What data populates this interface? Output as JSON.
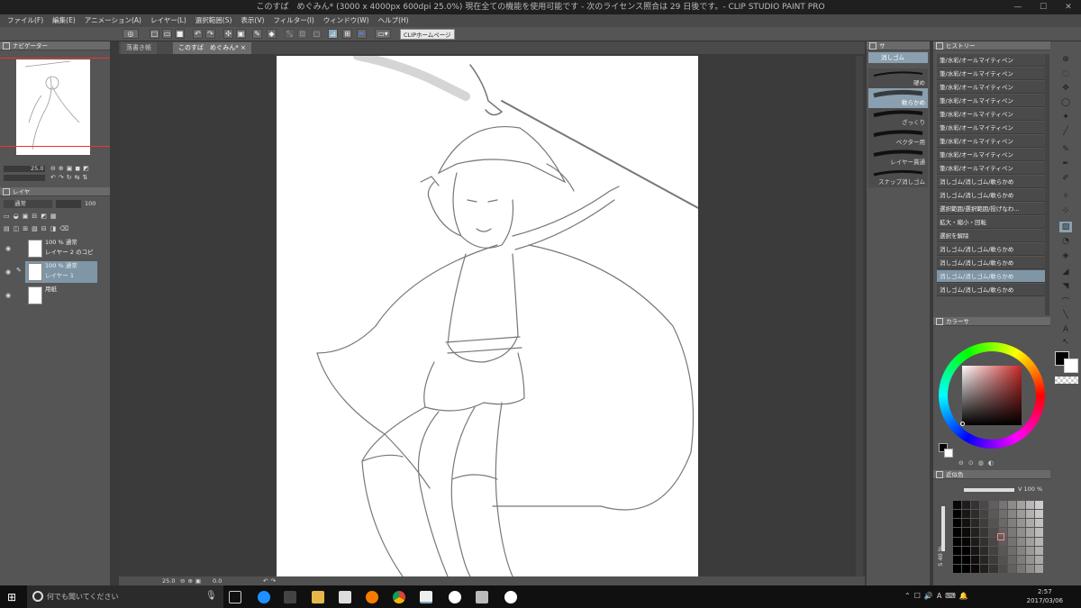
{
  "window": {
    "title": "このすば　めぐみん* (3000 x 4000px 600dpi 25.0%)  現在全ての機能を使用可能です - 次のライセンス照合は 29 日後です。- CLIP STUDIO PAINT PRO"
  },
  "menu": [
    "ファイル(F)",
    "編集(E)",
    "アニメーション(A)",
    "レイヤー(L)",
    "選択範囲(S)",
    "表示(V)",
    "フィルター(I)",
    "ウィンドウ(W)",
    "ヘルプ(H)"
  ],
  "toolbar": {
    "home_label": "CLIPホームページ"
  },
  "navigator": {
    "title": "ナビゲーター",
    "zoom": "25.0"
  },
  "layers": {
    "title": "レイヤ",
    "blend_mode": "通常",
    "opacity": "100",
    "items": [
      {
        "opacity_mode": "100 %  通常",
        "name": "レイヤー 2 のコピー"
      },
      {
        "opacity_mode": "100 %  通常",
        "name": "レイヤー 1"
      },
      {
        "opacity_mode": "",
        "name": "用紙"
      }
    ]
  },
  "canvas": {
    "tabs": [
      "落書き帳",
      "このすば　めぐみん*"
    ],
    "zoom": "25.0",
    "rotation": "0.0"
  },
  "subtool": {
    "title": "消しゴム",
    "tab": "サ",
    "brushes": [
      "硬め",
      "軟らかめ",
      "ざっくり",
      "ベクター用",
      "レイヤー貫通",
      "スナップ消しゴム"
    ]
  },
  "history": {
    "title": "ヒストリー",
    "items": [
      "筆/水彩/オールマイティペン",
      "筆/水彩/オールマイティペン",
      "筆/水彩/オールマイティペン",
      "筆/水彩/オールマイティペン",
      "筆/水彩/オールマイティペン",
      "筆/水彩/オールマイティペン",
      "筆/水彩/オールマイティペン",
      "筆/水彩/オールマイティペン",
      "筆/水彩/オールマイティペン",
      "消しゴム/消しゴム/軟らかめ",
      "消しゴム/消しゴム/軟らかめ",
      "選択範囲/選択範囲/投げなわ...",
      "拡大・縮小・回転",
      "選択を解除",
      "消しゴム/消しゴム/軟らかめ",
      "消しゴム/消しゴム/軟らかめ",
      "消しゴム/消しゴム/軟らかめ",
      "消しゴム/消しゴム/軟らかめ"
    ],
    "selected_index": 16
  },
  "color": {
    "title": "カラーサ",
    "approx_title": "近似色",
    "v_label": "V 100 %",
    "s_label": "S 40 %",
    "ring_hue_hex": "#c62828"
  },
  "taskbar": {
    "search_placeholder": "何でも聞いてください",
    "time": "2:57",
    "date": "2017/03/06"
  }
}
